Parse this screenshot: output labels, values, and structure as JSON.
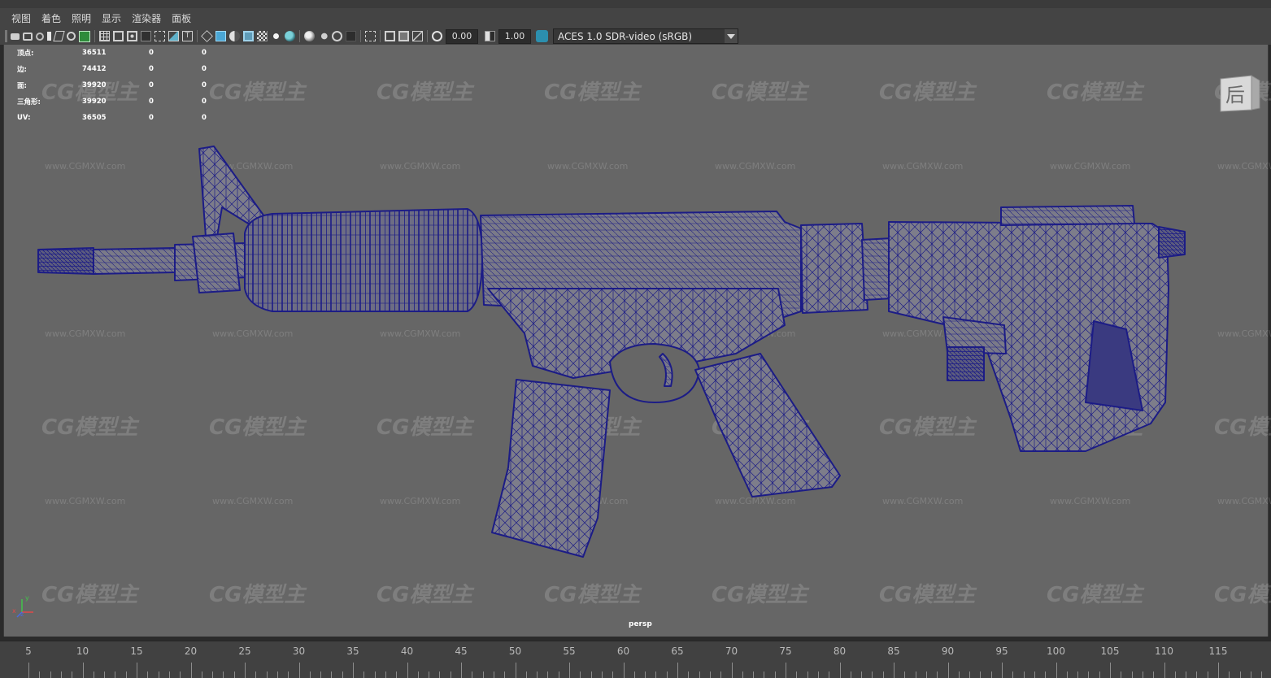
{
  "menu": [
    "视图",
    "着色",
    "照明",
    "显示",
    "渲染器",
    "面板"
  ],
  "toolbar": {
    "value_a": "0.00",
    "value_b": "1.00",
    "color_management": "ACES 1.0 SDR-video (sRGB)",
    "icons": [
      "camera-icon",
      "camera-attributes-icon",
      "bookmark-icon",
      "image-plane-icon",
      "grid-icon",
      "film-gate-icon",
      "resolution-gate-icon",
      "gate-mask-icon",
      "field-chart-icon",
      "safe-action-icon",
      "safe-title-icon",
      "wireframe-icon",
      "smooth-shade-icon",
      "default-material-icon",
      "wireframe-on-shaded-icon",
      "xray-icon",
      "use-lights-icon",
      "shadows-icon",
      "screen-space-ao-icon",
      "motion-blur-icon",
      "anti-aliasing-icon",
      "depth-of-field-icon",
      "isolate-select-icon",
      "two-sided-lighting-icon",
      "exposure-icon",
      "gamma-icon",
      "color-management-icon"
    ]
  },
  "hud": {
    "rows": [
      {
        "label": "顶点:",
        "value": "36511",
        "a": "0",
        "b": "0"
      },
      {
        "label": "边:",
        "value": "74412",
        "a": "0",
        "b": "0"
      },
      {
        "label": "面:",
        "value": "39920",
        "a": "0",
        "b": "0"
      },
      {
        "label": "三角形:",
        "value": "39920",
        "a": "0",
        "b": "0"
      },
      {
        "label": "UV:",
        "value": "36505",
        "a": "0",
        "b": "0"
      }
    ]
  },
  "viewport": {
    "camera_label": "persp",
    "viewcube_face": "后",
    "axis_labels": {
      "x": "x",
      "y": "y",
      "z": "z"
    }
  },
  "watermark": {
    "logo": "CG模型主",
    "url": "www.CGMXW.com"
  },
  "timeline": {
    "ticks": [
      "5",
      "10",
      "15",
      "20",
      "25",
      "30",
      "35",
      "40",
      "45",
      "50",
      "55",
      "60",
      "65",
      "70",
      "75",
      "80",
      "85",
      "90",
      "95",
      "100",
      "105",
      "110",
      "115"
    ]
  },
  "colors": {
    "viewport_bg": "#666666",
    "wireframe": "#1c1c86",
    "mesh_fill": "#7d7d8a",
    "ui_bg": "#444444"
  }
}
